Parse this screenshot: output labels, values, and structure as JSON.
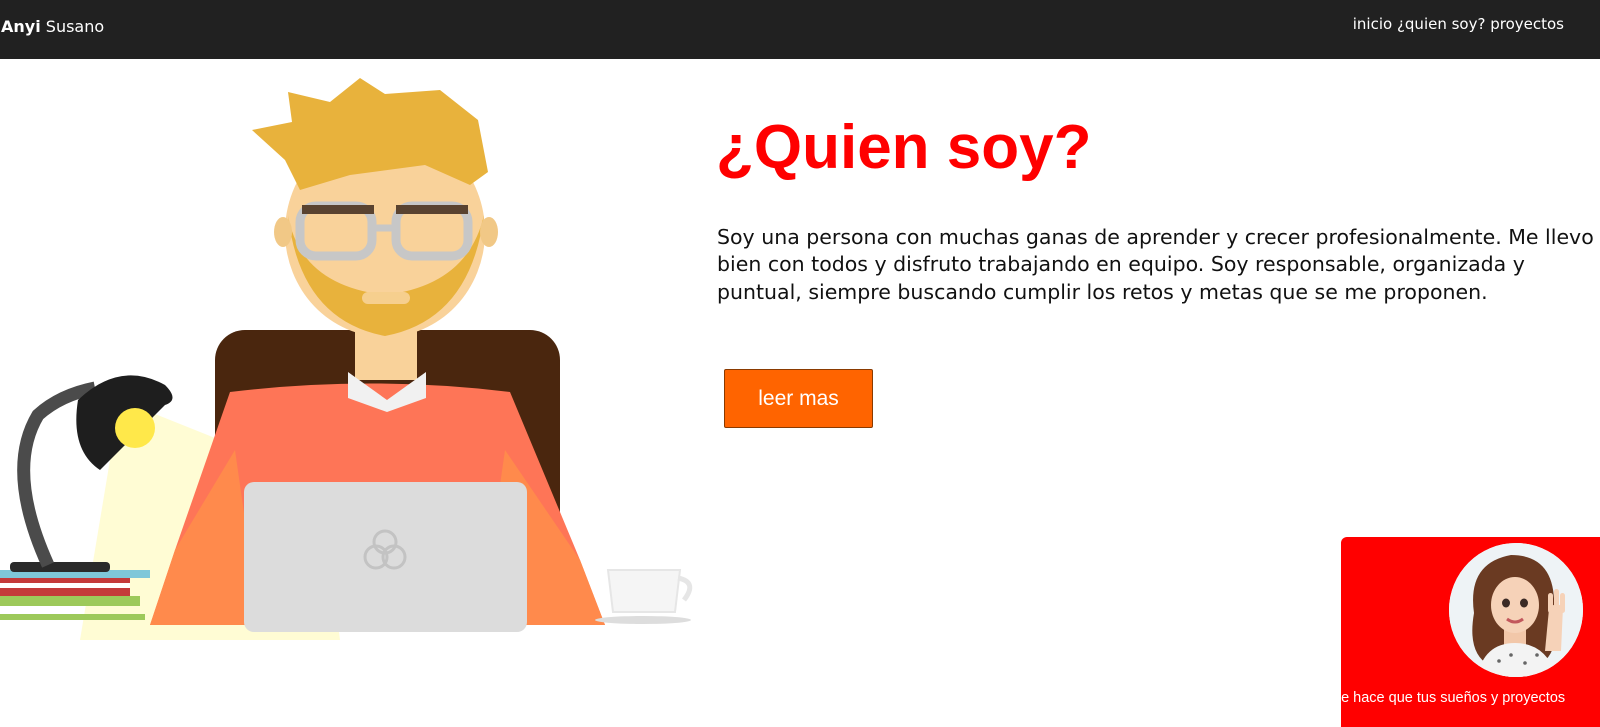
{
  "nav": {
    "brand_first": "Anyi",
    "brand_last": "Susano",
    "links": [
      "inicio",
      "¿quien soy?",
      "proyectos"
    ]
  },
  "hero": {
    "title": "¿Quien soy?",
    "description": "Soy una persona con muchas ganas de aprender y crecer profesionalmente. Me llevo bien con todos y disfruto trabajando en equipo. Soy responsable, organizada y puntual, siempre buscando cumplir los retos y metas que se me proponen.",
    "button_label": "leer mas"
  },
  "widget": {
    "marquee_text": "ue hace que tus sueños y proyectos"
  },
  "colors": {
    "navbar": "#212121",
    "title": "#ff0000",
    "button": "#ff6400",
    "widget": "#ff0000"
  },
  "icons": [
    "developer-illustration",
    "avatar-waving"
  ]
}
